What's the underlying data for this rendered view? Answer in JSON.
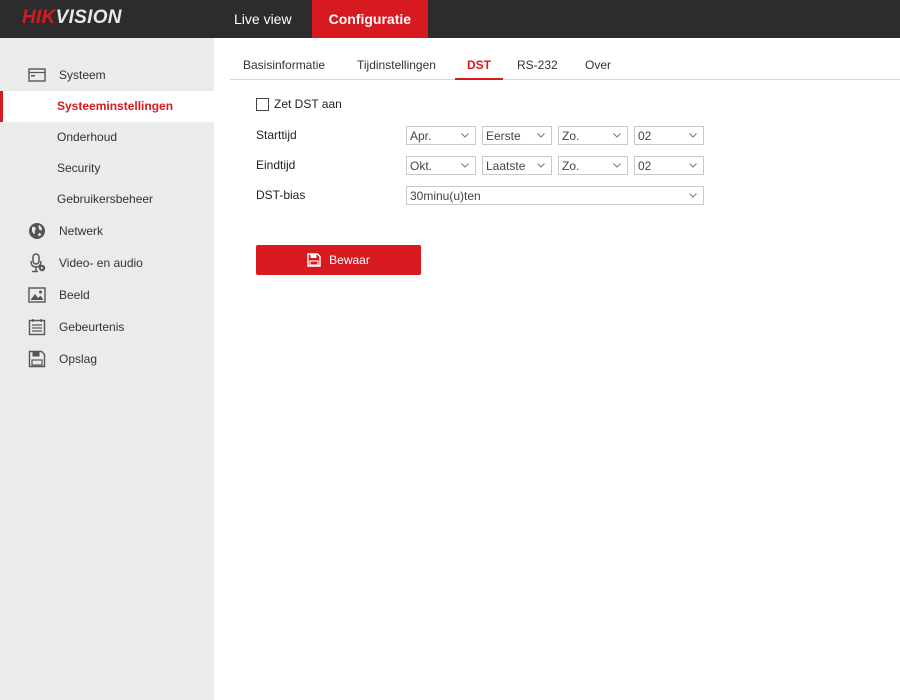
{
  "brand": {
    "logo_hik": "HIK",
    "logo_vision": "VISION",
    "accent": "#d71920"
  },
  "topnav": {
    "items": [
      {
        "label": "Live view"
      },
      {
        "label": "Configuratie"
      }
    ]
  },
  "sidebar": {
    "groups": [
      {
        "label": "Systeem",
        "icon": "monitor-icon"
      },
      {
        "label": "Netwerk",
        "icon": "globe-icon"
      },
      {
        "label": "Video- en audio",
        "icon": "microphone-icon"
      },
      {
        "label": "Beeld",
        "icon": "image-icon"
      },
      {
        "label": "Gebeurtenis",
        "icon": "calendar-icon"
      },
      {
        "label": "Opslag",
        "icon": "floppy-disk-icon"
      }
    ],
    "system_subitems": [
      {
        "label": "Systeeminstellingen"
      },
      {
        "label": "Onderhoud"
      },
      {
        "label": "Security"
      },
      {
        "label": "Gebruikersbeheer"
      }
    ]
  },
  "tabs": [
    {
      "label": "Basisinformatie"
    },
    {
      "label": "Tijdinstellingen"
    },
    {
      "label": "DST"
    },
    {
      "label": "RS-232"
    },
    {
      "label": "Over"
    }
  ],
  "form": {
    "enable_dst_label": "Zet DST aan",
    "enable_dst_checked": false,
    "start_label": "Starttijd",
    "start": {
      "month": "Apr.",
      "week": "Eerste",
      "day": "Zo.",
      "hour": "02"
    },
    "end_label": "Eindtijd",
    "end": {
      "month": "Okt.",
      "week": "Laatste",
      "day": "Zo.",
      "hour": "02"
    },
    "bias_label": "DST-bias",
    "bias": "30minu(u)ten"
  },
  "save_button": {
    "label": "Bewaar"
  }
}
